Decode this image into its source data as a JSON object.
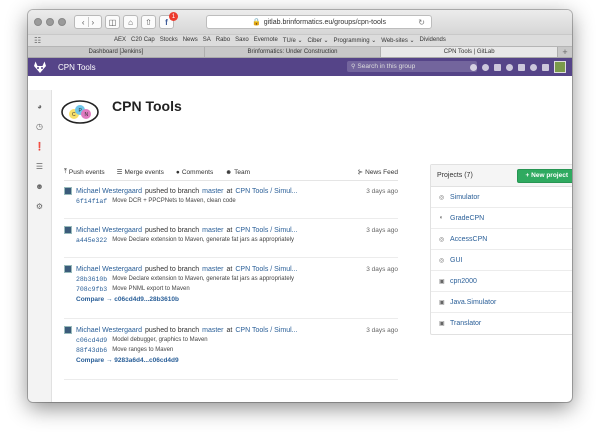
{
  "browser": {
    "url": "gitlab.brinformatics.eu/groups/cpn-tools",
    "facebook_badge": "1",
    "bookmarks": [
      "AEX",
      "C20 Cap",
      "Stocks",
      "News",
      "SA",
      "Rabo",
      "Saxo",
      "Evernote",
      "TU/e ⌄",
      "Ciber ⌄",
      "Programming ⌄",
      "Web-sites ⌄",
      "Dividends"
    ],
    "tabs": [
      {
        "label": "Dashboard [Jenkins]",
        "active": false
      },
      {
        "label": "Brinformatics: Under Construction",
        "active": false
      },
      {
        "label": "CPN Tools | GitLab",
        "active": true
      }
    ]
  },
  "header": {
    "title": "CPN Tools",
    "search_placeholder": "Search in this group"
  },
  "group": {
    "name": "CPN Tools"
  },
  "feed_tabs": [
    {
      "label": "Push events",
      "icon": "upload-icon"
    },
    {
      "label": "Merge events",
      "icon": "merge-icon"
    },
    {
      "label": "Comments",
      "icon": "comment-icon"
    },
    {
      "label": "Team",
      "icon": "user-icon"
    }
  ],
  "news_feed": "News Feed",
  "events": [
    {
      "author": "Michael Westergaard",
      "action": "pushed to branch",
      "branch": "master",
      "at": "at",
      "project": "CPN Tools / Simul...",
      "time": "3 days ago",
      "commits": [
        {
          "sha": "6f14f1af",
          "msg": "Move DCR + PPCPNets to Maven, clean code"
        }
      ],
      "compare": ""
    },
    {
      "author": "Michael Westergaard",
      "action": "pushed to branch",
      "branch": "master",
      "at": "at",
      "project": "CPN Tools / Simul...",
      "time": "3 days ago",
      "commits": [
        {
          "sha": "a445e322",
          "msg": "Move Declare extension to Maven, generate fat jars as appropriately"
        }
      ],
      "compare": ""
    },
    {
      "author": "Michael Westergaard",
      "action": "pushed to branch",
      "branch": "master",
      "at": "at",
      "project": "CPN Tools / Simul...",
      "time": "3 days ago",
      "commits": [
        {
          "sha": "28b3610b",
          "msg": "Move Declare extension to Maven, generate fat jars as appropriately"
        },
        {
          "sha": "708c9fb3",
          "msg": "Move PNML export to Maven"
        }
      ],
      "compare": "Compare → c06cd4d9...28b3610b"
    },
    {
      "author": "Michael Westergaard",
      "action": "pushed to branch",
      "branch": "master",
      "at": "at",
      "project": "CPN Tools / Simul...",
      "time": "3 days ago",
      "commits": [
        {
          "sha": "c06cd4d9",
          "msg": "Model debugger, graphics to Maven"
        },
        {
          "sha": "88f43db6",
          "msg": "Move ranges to Maven"
        }
      ],
      "compare": "Compare → 9283a6d4...c06cd4d9"
    }
  ],
  "projects_panel": {
    "title": "Projects (7)",
    "new_project": "+ New project",
    "items": [
      {
        "name": "Simulator",
        "icon": "globe-icon"
      },
      {
        "name": "GradeCPN",
        "icon": "shield-icon"
      },
      {
        "name": "AccessCPN",
        "icon": "globe-icon"
      },
      {
        "name": "GUI",
        "icon": "globe-icon"
      },
      {
        "name": "cpn2000",
        "icon": "lock-icon"
      },
      {
        "name": "Java.Simulator",
        "icon": "lock-icon"
      },
      {
        "name": "Translator",
        "icon": "lock-icon"
      }
    ]
  },
  "colors": {
    "header_purple": "#554488",
    "link_blue": "#2a5f98",
    "new_project_green": "#2faa60"
  }
}
